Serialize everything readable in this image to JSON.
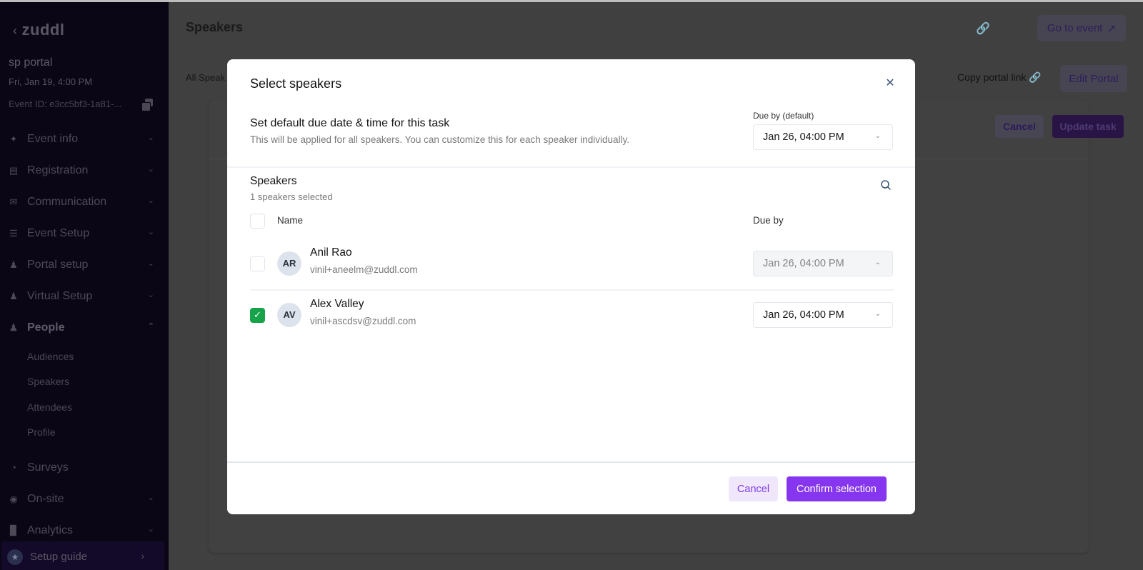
{
  "sidebar": {
    "logo": "zuddl",
    "event_name": "sp portal",
    "event_date": "Fri, Jan 19, 4:00 PM",
    "event_id": "Event ID: e3cc5bf3-1a81-...",
    "nav": [
      {
        "label": "Event info",
        "icon": "wand-icon",
        "expanded": false
      },
      {
        "label": "Registration",
        "icon": "form-icon",
        "expanded": false
      },
      {
        "label": "Communication",
        "icon": "mail-icon",
        "expanded": false
      },
      {
        "label": "Event Setup",
        "icon": "signpost-icon",
        "expanded": false
      },
      {
        "label": "Portal setup",
        "icon": "people-icon",
        "expanded": false
      },
      {
        "label": "Virtual Setup",
        "icon": "people-icon",
        "expanded": false
      },
      {
        "label": "People",
        "icon": "people-icon",
        "expanded": true
      }
    ],
    "people_subitems": [
      "Audiences",
      "Speakers",
      "Attendees",
      "Profile"
    ],
    "nav_bottom": [
      {
        "label": "Surveys",
        "icon": "pie-icon"
      },
      {
        "label": "On-site",
        "icon": "compass-icon"
      },
      {
        "label": "Analytics",
        "icon": "bar-chart-icon"
      }
    ],
    "setup_guide": "Setup guide"
  },
  "main": {
    "title": "Speakers",
    "go_to_event": "Go to event",
    "tabs_partial": "All Speak",
    "copy_portal_link": "Copy portal link",
    "edit_portal": "Edit Portal",
    "card_cancel": "Cancel",
    "card_update": "Update task"
  },
  "modal": {
    "title": "Select speakers",
    "default_section": {
      "title": "Set default due date & time for this task",
      "description": "This will be applied for all speakers. You can customize this for each speaker individually.",
      "due_label": "Due by (default)",
      "due_value": "Jan 26, 04:00 PM"
    },
    "speakers": {
      "title": "Speakers",
      "count_text": "1 speakers selected",
      "columns": {
        "name": "Name",
        "due": "Due by"
      },
      "rows": [
        {
          "initials": "AR",
          "name": "Anil Rao",
          "email": "vinil+aneelm@zuddl.com",
          "due": "Jan 26, 04:00 PM",
          "selected": false
        },
        {
          "initials": "AV",
          "name": "Alex Valley",
          "email": "vinil+ascdsv@zuddl.com",
          "due": "Jan 26, 04:00 PM",
          "selected": true
        }
      ]
    },
    "footer": {
      "cancel": "Cancel",
      "confirm": "Confirm selection"
    }
  },
  "colors": {
    "primary": "#8536ee",
    "primary_light": "#f1e7fd",
    "checked": "#17a34a",
    "sidebar_bg": "#0b0616"
  }
}
